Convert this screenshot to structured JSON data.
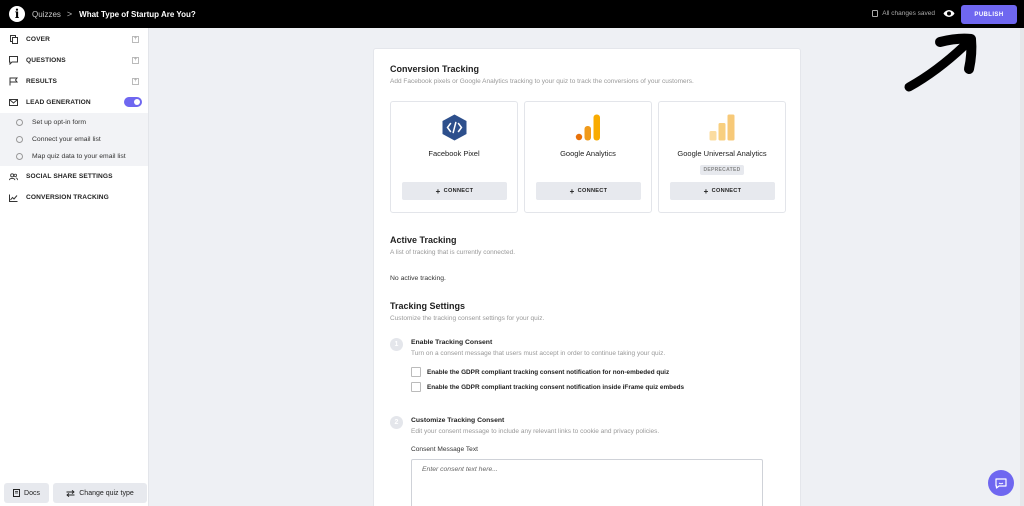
{
  "topbar": {
    "logo_letter": "i",
    "breadcrumb_root": "Quizzes",
    "separator": ">",
    "quiz_title": "What Type of Startup Are You?",
    "save_status": "All changes saved",
    "publish_label": "PUBLISH"
  },
  "sidebar": {
    "items": [
      {
        "label": "COVER",
        "icon": "pages-icon"
      },
      {
        "label": "QUESTIONS",
        "icon": "chat-icon"
      },
      {
        "label": "RESULTS",
        "icon": "flag-icon"
      },
      {
        "label": "LEAD GENERATION",
        "icon": "mail-icon",
        "toggle_on": true
      },
      {
        "label": "SOCIAL SHARE SETTINGS",
        "icon": "users-icon"
      },
      {
        "label": "CONVERSION TRACKING",
        "icon": "chart-icon"
      }
    ],
    "lead_sub_items": [
      "Set up opt-in form",
      "Connect your email list",
      "Map quiz data to your email list"
    ],
    "footer": {
      "docs_label": "Docs",
      "change_type_label": "Change quiz type"
    }
  },
  "conversion": {
    "title": "Conversion Tracking",
    "description": "Add Facebook pixels or Google Analytics tracking to your quiz to track the conversions of your customers.",
    "integrations": [
      {
        "name": "Facebook Pixel",
        "icon": "code-hex-icon",
        "connect_label": "CONNECT"
      },
      {
        "name": "Google Analytics",
        "icon": "analytics-bars-icon",
        "connect_label": "CONNECT"
      },
      {
        "name": "Google Universal Analytics",
        "icon": "analytics-bars-light-icon",
        "badge": "DEPRECATED",
        "connect_label": "CONNECT"
      }
    ]
  },
  "active": {
    "title": "Active Tracking",
    "description": "A list of tracking that is currently connected.",
    "empty_text": "No active tracking."
  },
  "settings": {
    "title": "Tracking Settings",
    "description": "Customize the tracking consent settings for your quiz.",
    "step1": {
      "number": "1",
      "title": "Enable Tracking Consent",
      "description": "Turn on a consent message that users must accept in order to continue taking your quiz.",
      "options": [
        "Enable the GDPR compliant tracking consent notification for non-embeded quiz",
        "Enable the GDPR compliant tracking consent notification inside iFrame quiz embeds"
      ]
    },
    "step2": {
      "number": "2",
      "title": "Customize Tracking Consent",
      "description": "Edit your consent message to include any relevant links to cookie and privacy policies.",
      "field_label": "Consent Message Text",
      "placeholder": "Enter consent text here..."
    }
  },
  "colors": {
    "accent": "#6f67f0",
    "topbar": "#000000",
    "facebook_hex": "#2d4f8c",
    "ga_orange": "#f09a1a",
    "ua_yellow": "#f7c978"
  }
}
